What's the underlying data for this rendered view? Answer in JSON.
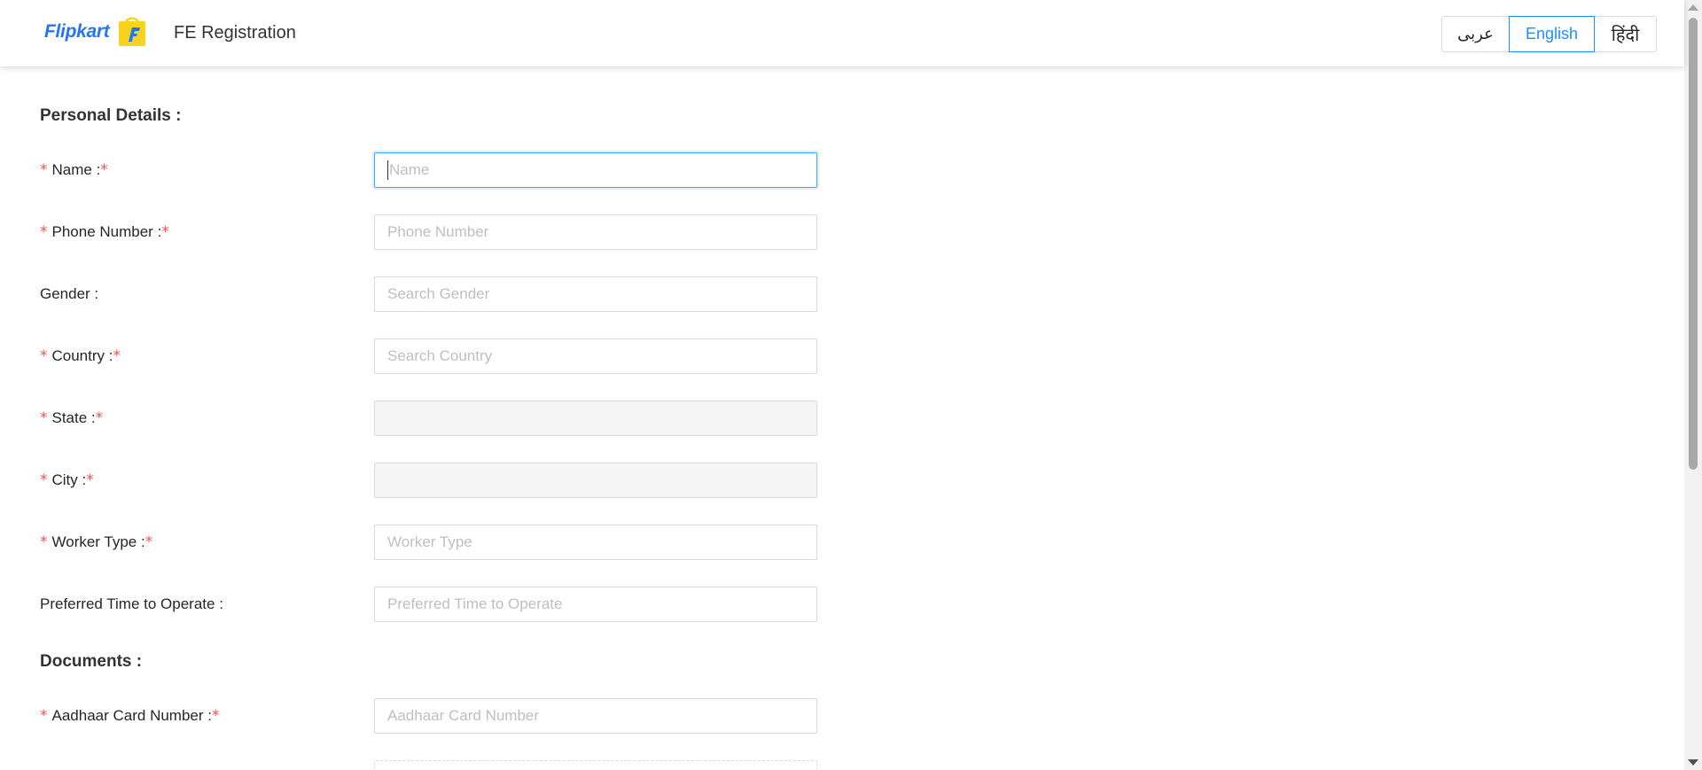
{
  "header": {
    "brand": "Flipkart",
    "title": "FE Registration",
    "languages": [
      "عربى",
      "English",
      "हिंदी"
    ],
    "active_language": "English"
  },
  "colors": {
    "accent": "#1890ff",
    "brand_blue": "#2874f0",
    "brand_yellow": "#f8d31c",
    "required": "#ff4d4f"
  },
  "sections": {
    "personal": "Personal Details :",
    "documents": "Documents :"
  },
  "fields": {
    "name": {
      "label": "Name :",
      "placeholder": "Name",
      "required": true
    },
    "phone": {
      "label": "Phone Number :",
      "placeholder": "Phone Number",
      "required": true
    },
    "gender": {
      "label": "Gender :",
      "placeholder": "Search Gender",
      "required": false
    },
    "country": {
      "label": "Country :",
      "placeholder": "Search Country",
      "required": true
    },
    "state": {
      "label": "State :",
      "placeholder": "",
      "required": true
    },
    "city": {
      "label": "City :",
      "placeholder": "",
      "required": true
    },
    "worker_type": {
      "label": "Worker Type :",
      "placeholder": "Worker Type",
      "required": true
    },
    "preferred_time": {
      "label": "Preferred Time to Operate :",
      "placeholder": "Preferred Time to Operate",
      "required": false
    },
    "aadhaar": {
      "label": "Aadhaar Card Number :",
      "placeholder": "Aadhaar Card Number",
      "required": true
    }
  },
  "required_mark": "*"
}
